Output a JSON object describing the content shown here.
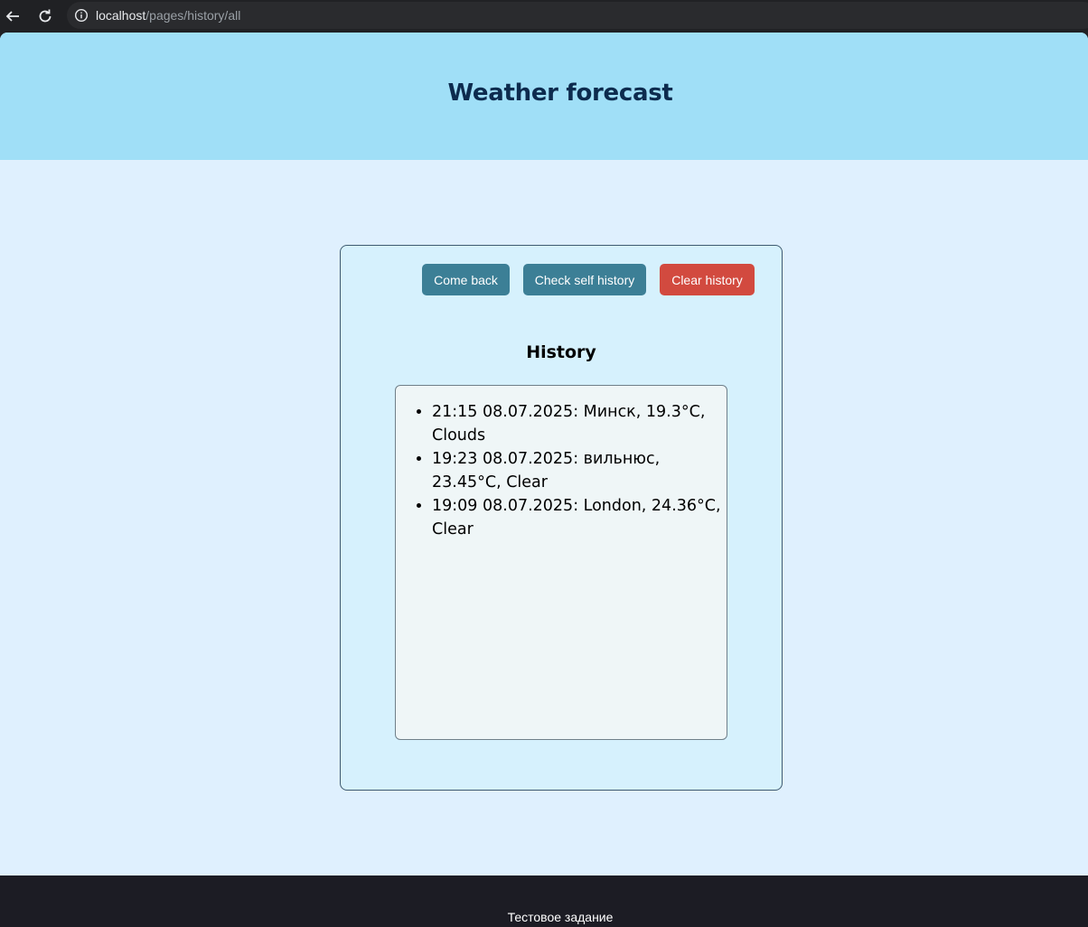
{
  "browser": {
    "url_host": "localhost",
    "url_path": "/pages/history/all"
  },
  "header": {
    "title": "Weather forecast"
  },
  "card": {
    "buttons": {
      "come_back": "Come back",
      "check_self_history": "Check self history",
      "clear_history": "Clear history"
    },
    "history_title": "History",
    "history_items": [
      "21:15 08.07.2025: Минск, 19.3°C, Clouds",
      "19:23 08.07.2025: вильнюс, 23.45°C, Clear",
      "19:09 08.07.2025: London, 24.36°C, Clear"
    ]
  },
  "footer": {
    "text": "Тестовое задание"
  },
  "colors": {
    "header_bg": "#a0dff7",
    "page_bg": "#dff0fe",
    "primary_button": "#3c7f96",
    "danger_button": "#d24a3f",
    "footer_bg": "#1c1c24"
  },
  "icons": {
    "back": "arrow-left-icon",
    "reload": "reload-icon",
    "site_info": "info-icon"
  }
}
